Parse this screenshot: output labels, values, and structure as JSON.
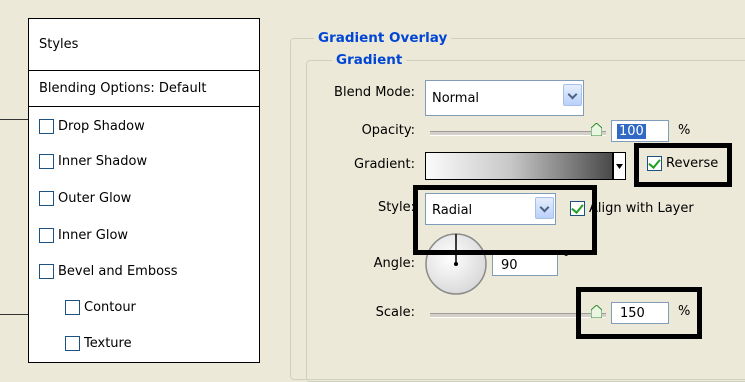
{
  "panel": {
    "header": "Styles",
    "blending": "Blending Options: Default",
    "items": [
      {
        "label": "Drop Shadow"
      },
      {
        "label": "Inner Shadow"
      },
      {
        "label": "Outer Glow"
      },
      {
        "label": "Inner Glow"
      },
      {
        "label": "Bevel and Emboss"
      },
      {
        "label": "Contour"
      },
      {
        "label": "Texture"
      }
    ]
  },
  "section": {
    "title": "Gradient Overlay",
    "subtitle": "Gradient"
  },
  "blend_mode": {
    "label": "Blend Mode:",
    "value": "Normal"
  },
  "opacity": {
    "label": "Opacity:",
    "value": "100",
    "unit": "%",
    "level": 1.0
  },
  "gradient": {
    "label": "Gradient:",
    "reverse_label": "Reverse",
    "reverse_checked": true
  },
  "style": {
    "label": "Style:",
    "value": "Radial",
    "align_label": "Align with Layer",
    "align_checked": true
  },
  "angle": {
    "label": "Angle:",
    "value": "90",
    "unit": "°"
  },
  "scale": {
    "label": "Scale:",
    "value": "150",
    "unit": "%"
  },
  "colors": {
    "accent": "#0046d5",
    "check": "#21a121",
    "highlight_box": "#000000"
  }
}
